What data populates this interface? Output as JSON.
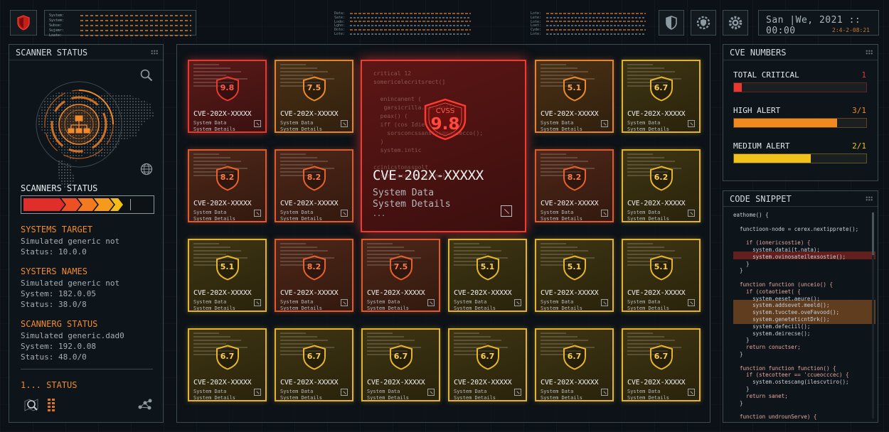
{
  "top": {
    "sys_rows": [
      "System:",
      "System:",
      "Subse:",
      "Sujemr:",
      "Loate:"
    ],
    "data_rows_1": [
      "Data:",
      "Sate:",
      "Lodo:",
      "Lgho:",
      "Doto:",
      "Lote:"
    ],
    "data_rows_2": [
      "Lote:",
      "Lete:",
      "Lote:",
      "Loet:",
      "Cyde:",
      "Lote:"
    ],
    "clock_time": "San |We, 2021 :: 00:00",
    "clock_date": "2:4-2-08:21"
  },
  "scanner_panel": {
    "title": "SCANNER STATUS",
    "scanners_status_label": "SCANNERS STATUS",
    "progress_segments": [
      "#e02f2a",
      "#ee4f25",
      "#f47a1f",
      "#f59a1d",
      "#f3bd18"
    ],
    "sections": [
      {
        "title": "SYSTEMS TARGET",
        "lines": [
          "Simulated generic not",
          "Status: 10.0.0"
        ]
      },
      {
        "title": "SYSTERS NAMES",
        "lines": [
          "Simulated generic not",
          "System: 182.0.05",
          "Status: 38.0/8"
        ]
      },
      {
        "title": "SCANNERG STATUS",
        "lines": [
          "Simulated generic.dad0",
          "System: 192.0.08",
          "Status: 48.0/0"
        ]
      }
    ],
    "footer_status": "1... STATUS"
  },
  "featured": {
    "cvss_label": "CVSS",
    "cvss_value": "9.8",
    "cve_id": "CVE-202X-XXXXX",
    "line1": "System Data",
    "line2": "System Details",
    "line3": "...",
    "code_text": "critical 12\nsomericelecritsrect(]\n\n  enincanent (\n   garsicrilla.secceni[]\n  peax() (\n  iff (cos Idie\n    sorsconcssanstjsmmonsecco();\n  )\n  system.intic\n\nccinicstonsspolt\n  sinn.acc)on.ssstns]"
  },
  "cards": [
    {
      "score": "9.8",
      "color": "red"
    },
    {
      "score": "7.5",
      "color": "orange"
    },
    {
      "score": "5.1",
      "color": "orange"
    },
    {
      "score": "6.7",
      "color": "yellow"
    },
    {
      "score": "8.2",
      "color": "ored"
    },
    {
      "score": "8.2",
      "color": "ored"
    },
    {
      "score": "8.2",
      "color": "ored"
    },
    {
      "score": "6.2",
      "color": "yellow"
    },
    {
      "score": "5.1",
      "color": "yellow"
    },
    {
      "score": "8.2",
      "color": "ored"
    },
    {
      "score": "7.5",
      "color": "ored"
    },
    {
      "score": "5.1",
      "color": "yellow"
    },
    {
      "score": "5.1",
      "color": "yellow"
    },
    {
      "score": "5.1",
      "color": "yellow"
    },
    {
      "score": "6.7",
      "color": "yellow"
    },
    {
      "score": "6.7",
      "color": "yellow"
    },
    {
      "score": "6.7",
      "color": "yellow"
    },
    {
      "score": "6.7",
      "color": "yellow"
    },
    {
      "score": "6.7",
      "color": "yellow"
    },
    {
      "score": "6.7",
      "color": "yellow"
    }
  ],
  "card_text": {
    "cve": "CVE-202X-XXXXX",
    "line1": "System Data",
    "line2": "System Details",
    "line3": "..."
  },
  "cve_numbers": {
    "title": "CVE NUMBERS",
    "metrics": [
      {
        "label": "TOTAL CRITICAL",
        "value": "1",
        "color": "#e8392f",
        "fill": 0.06
      },
      {
        "label": "HIGH ALERT",
        "value": "3/1",
        "color": "#f08a1e",
        "fill": 0.78
      },
      {
        "label": "MEDIUM ALERT",
        "value": "2/1",
        "color": "#f1c21b",
        "fill": 0.58
      }
    ]
  },
  "code_snippet": {
    "title": "CODE SNIPPET",
    "lines": [
      "eathome() {",
      "",
      "  functioon-node = cerex.nextipprete();",
      "",
      "    if (ionericsostie) {",
      "      system.datai(t.nata);",
      "      system.ovinosateilexsostie();",
      "    }",
      "  }",
      "",
      "  function function (unceio() {",
      "    if (cotaotieet( {",
      "      system.eeset.aeure();",
      "      system.addsevet.meeld();",
      "      system.tvoctee.oveFavood();",
      "      system.geneteticntDrk();",
      "      system.defeciil();",
      "      system.deirecse();",
      "    }",
      "    return conuctser;",
      "  }",
      "",
      "  function function function() {",
      "    if (stecotteer == 'ccueocccec) {",
      "      system.ostescang(ilescvtiro();",
      "    }",
      "    return sanet;",
      "  }",
      "",
      "  function undrounServe) {"
    ]
  }
}
